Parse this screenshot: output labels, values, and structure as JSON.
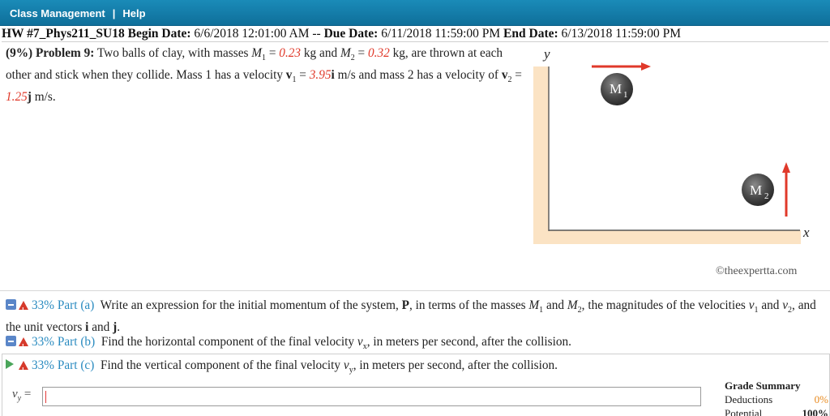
{
  "topbar": {
    "class_management": "Class Management",
    "separator": "|",
    "help": "Help"
  },
  "hw": {
    "title": "HW #7_Phys211_SU18",
    "begin_label": "Begin Date:",
    "begin_value": "6/6/2018 12:01:00 AM",
    "dash": "--",
    "due_label": "Due Date:",
    "due_value": "6/11/2018 11:59:00 PM",
    "end_label": "End Date:",
    "end_value": "6/13/2018 11:59:00 PM"
  },
  "problem": {
    "header": "(9%) Problem 9:",
    "m1_value": "0.23",
    "m2_value": "0.32",
    "v1_value": "3.95",
    "v2_value": "1.25"
  },
  "figure": {
    "axis_y": "y",
    "axis_x": "x",
    "ball1_label": "M",
    "ball1_sub": "1",
    "ball2_label": "M",
    "ball2_sub": "2",
    "copyright": "©theexpertta.com",
    "shadow_color": "#fbe3c4",
    "arrow_color": "#e0392a"
  },
  "parts": {
    "a_pct": "33% Part (a)",
    "b_pct": "33% Part (b)",
    "c_pct": "33% Part (c)",
    "b_text_pre": "Find the horizontal component of the final velocity",
    "b_text_post": ", in meters per second, after the collision.",
    "c_text_pre": "Find the vertical component of the final velocity",
    "c_text_post": ", in meters per second, after the collision."
  },
  "answer": {
    "label": "v",
    "label_sub": "y",
    "equals": "=",
    "value": ""
  },
  "grade": {
    "title": "Grade Summary",
    "deductions_label": "Deductions",
    "deductions_value": "0%",
    "potential_label": "Potential",
    "potential_value": "100%"
  }
}
